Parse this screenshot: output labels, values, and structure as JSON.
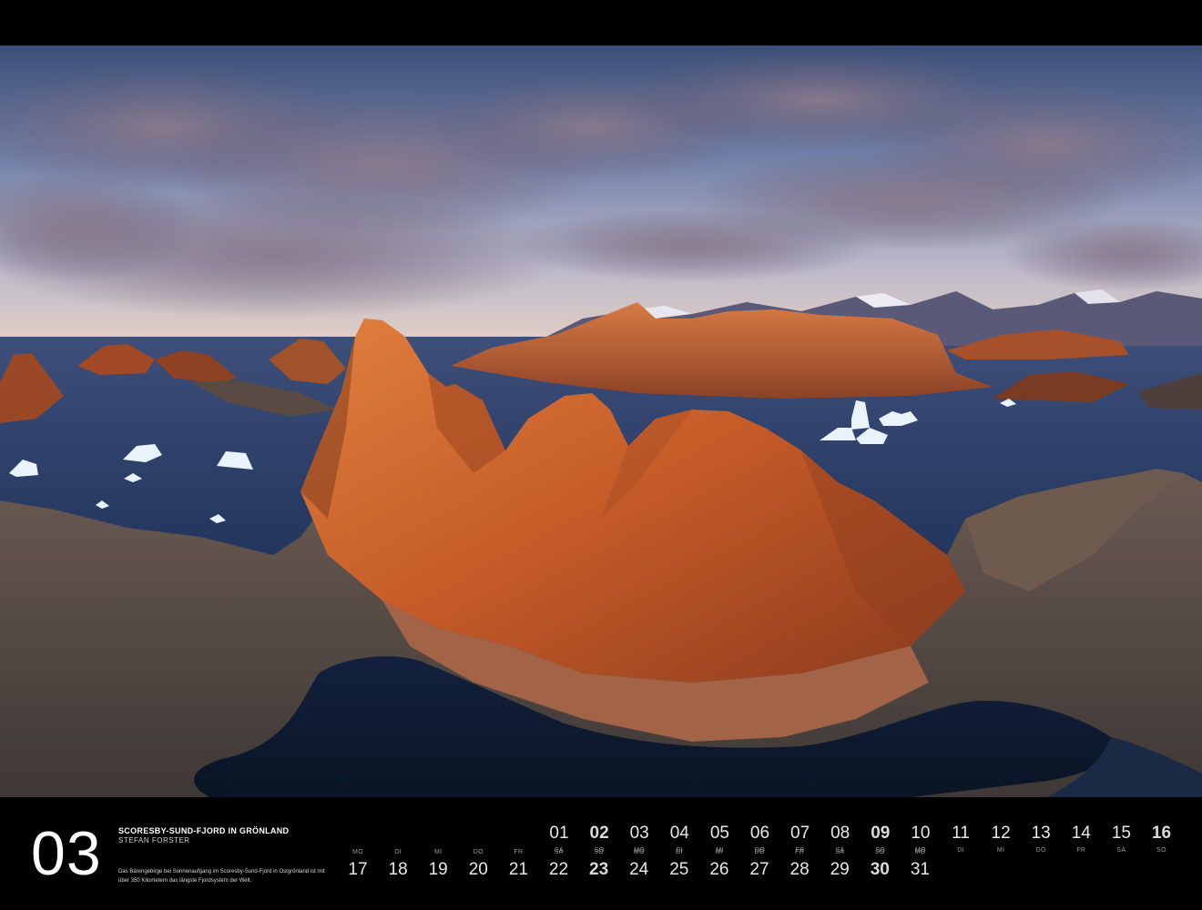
{
  "month": "03",
  "caption": {
    "title": "SCORESBY-SUND-FJORD IN GRÖNLAND",
    "author": "STEFAN FORSTER",
    "text": "Das Bärengebirge bei Sonnenaufgang im Scoresby-Sund-Fjord in Ostgrönland ist mit über 350 Kilometern das längste Fjordsystem der Welt."
  },
  "photo_subject": "mountains-fjord-icebergs-photo",
  "colors": {
    "background": "#000000",
    "text": "#ffffff",
    "weekday": "#9a9a9a"
  },
  "days_row1": [
    {
      "num": "01",
      "wd": "SA",
      "sunday": false
    },
    {
      "num": "02",
      "wd": "SO",
      "sunday": true
    },
    {
      "num": "03",
      "wd": "MO",
      "sunday": false
    },
    {
      "num": "04",
      "wd": "DI",
      "sunday": false
    },
    {
      "num": "05",
      "wd": "MI",
      "sunday": false
    },
    {
      "num": "06",
      "wd": "DO",
      "sunday": false
    },
    {
      "num": "07",
      "wd": "FR",
      "sunday": false
    },
    {
      "num": "08",
      "wd": "SA",
      "sunday": false
    },
    {
      "num": "09",
      "wd": "SO",
      "sunday": true
    },
    {
      "num": "10",
      "wd": "MO",
      "sunday": false
    },
    {
      "num": "11",
      "wd": "DI",
      "sunday": false
    },
    {
      "num": "12",
      "wd": "MI",
      "sunday": false
    },
    {
      "num": "13",
      "wd": "DO",
      "sunday": false
    },
    {
      "num": "14",
      "wd": "FR",
      "sunday": false
    },
    {
      "num": "15",
      "wd": "SA",
      "sunday": false
    },
    {
      "num": "16",
      "wd": "SO",
      "sunday": true
    }
  ],
  "days_row2": [
    {
      "num": "17",
      "wd": "MO",
      "sunday": false
    },
    {
      "num": "18",
      "wd": "DI",
      "sunday": false
    },
    {
      "num": "19",
      "wd": "MI",
      "sunday": false
    },
    {
      "num": "20",
      "wd": "DO",
      "sunday": false
    },
    {
      "num": "21",
      "wd": "FR",
      "sunday": false
    },
    {
      "num": "22",
      "wd": "SA",
      "sunday": false
    },
    {
      "num": "23",
      "wd": "SO",
      "sunday": true
    },
    {
      "num": "24",
      "wd": "MO",
      "sunday": false
    },
    {
      "num": "25",
      "wd": "DI",
      "sunday": false
    },
    {
      "num": "26",
      "wd": "MI",
      "sunday": false
    },
    {
      "num": "27",
      "wd": "DO",
      "sunday": false
    },
    {
      "num": "28",
      "wd": "FR",
      "sunday": false
    },
    {
      "num": "29",
      "wd": "SA",
      "sunday": false
    },
    {
      "num": "30",
      "wd": "SO",
      "sunday": true
    },
    {
      "num": "31",
      "wd": "MO",
      "sunday": false
    }
  ]
}
